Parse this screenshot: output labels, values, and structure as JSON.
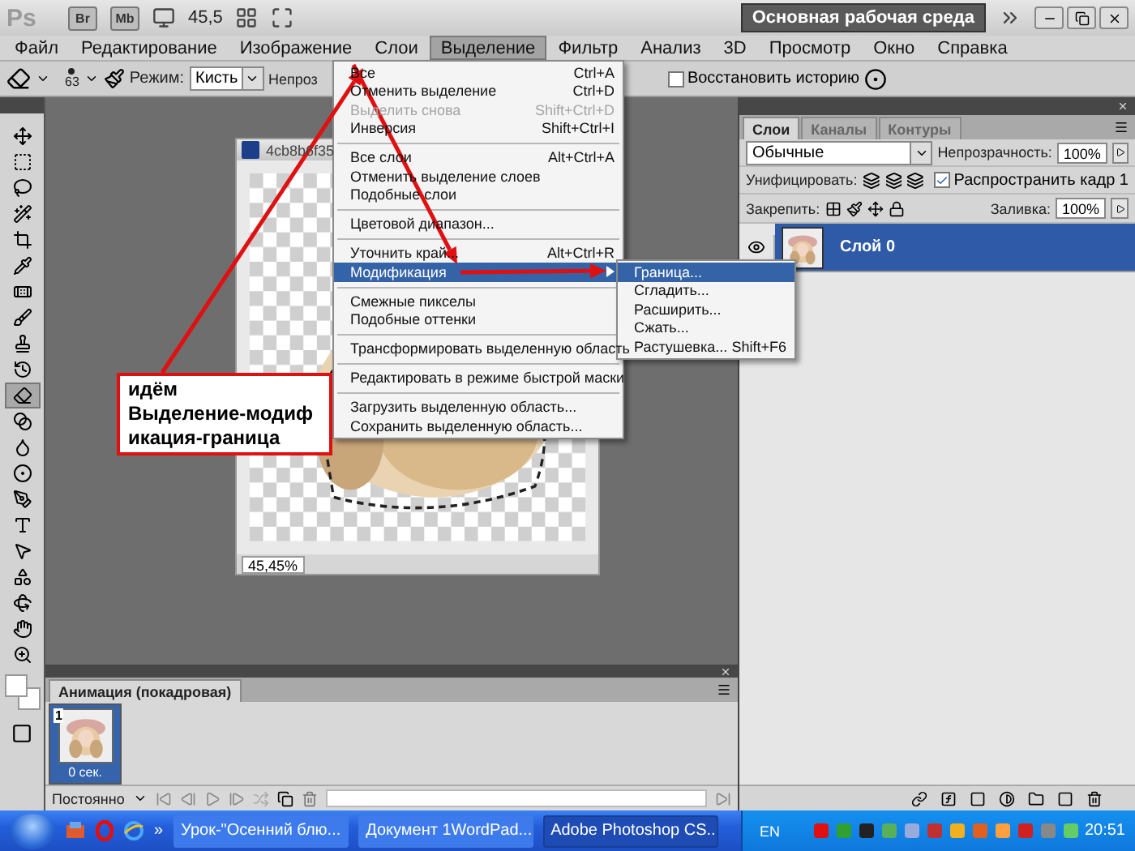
{
  "app_bar": {
    "logo": "Ps",
    "buttons": [
      "Br",
      "Mb"
    ],
    "zoom": "45,5",
    "workspace": "Основная рабочая среда"
  },
  "menu_bar": [
    {
      "label": "Файл",
      "selected": false
    },
    {
      "label": "Редактирование",
      "selected": false
    },
    {
      "label": "Изображение",
      "selected": false
    },
    {
      "label": "Слои",
      "selected": false
    },
    {
      "label": "Выделение",
      "selected": true
    },
    {
      "label": "Фильтр",
      "selected": false
    },
    {
      "label": "Анализ",
      "selected": false
    },
    {
      "label": "3D",
      "selected": false
    },
    {
      "label": "Просмотр",
      "selected": false
    },
    {
      "label": "Окно",
      "selected": false
    },
    {
      "label": "Справка",
      "selected": false
    }
  ],
  "options_bar": {
    "brush_size": "63",
    "mode_label": "Режим:",
    "mode_value": "Кисть",
    "opacity_label": "Непроз",
    "restore_history": {
      "label": "Восстановить историю",
      "checked": false
    }
  },
  "tools": [
    {
      "selected": false
    },
    {
      "selected": false
    },
    {
      "selected": false
    },
    {
      "selected": false
    },
    {
      "selected": false
    },
    {
      "selected": false
    },
    {
      "selected": false
    },
    {
      "selected": false
    },
    {
      "selected": false
    },
    {
      "selected": false
    },
    {
      "selected": true
    },
    {
      "selected": false
    },
    {
      "selected": false
    },
    {
      "selected": false
    },
    {
      "selected": false
    },
    {
      "selected": false
    },
    {
      "selected": false
    },
    {
      "selected": false
    },
    {
      "selected": false
    },
    {
      "selected": false
    },
    {
      "selected": false
    }
  ],
  "document": {
    "title": "4cb8b6f35",
    "zoom": "45,45%"
  },
  "dropdown_menu": {
    "sections": [
      [
        {
          "label": "Все",
          "shortcut": "Ctrl+A",
          "disabled": false,
          "selected": false
        },
        {
          "label": "Отменить выделение",
          "shortcut": "Ctrl+D",
          "disabled": false,
          "selected": false
        },
        {
          "label": "Выделить снова",
          "shortcut": "Shift+Ctrl+D",
          "disabled": true,
          "selected": false
        },
        {
          "label": "Инверсия",
          "shortcut": "Shift+Ctrl+I",
          "disabled": false,
          "selected": false
        }
      ],
      [
        {
          "label": "Все слои",
          "shortcut": "Alt+Ctrl+A",
          "disabled": false,
          "selected": false
        },
        {
          "label": "Отменить выделение слоев",
          "disabled": false,
          "selected": false
        },
        {
          "label": "Подобные слои",
          "disabled": false,
          "selected": false
        }
      ],
      [
        {
          "label": "Цветовой диапазон...",
          "disabled": false,
          "selected": false
        }
      ],
      [
        {
          "label": "Уточнить край...",
          "shortcut": "Alt+Ctrl+R",
          "disabled": false,
          "selected": false
        },
        {
          "label": "Модификация",
          "disabled": false,
          "selected": true,
          "submenu": true
        }
      ],
      [
        {
          "label": "Смежные пикселы",
          "disabled": false,
          "selected": false
        },
        {
          "label": "Подобные оттенки",
          "disabled": false,
          "selected": false
        }
      ],
      [
        {
          "label": "Трансформировать выделенную область",
          "disabled": false,
          "selected": false
        }
      ],
      [
        {
          "label": "Редактировать в режиме быстрой маски",
          "disabled": false,
          "selected": false
        }
      ],
      [
        {
          "label": "Загрузить выделенную область...",
          "disabled": false,
          "selected": false
        },
        {
          "label": "Сохранить выделенную область...",
          "disabled": false,
          "selected": false
        }
      ]
    ]
  },
  "submenu": [
    {
      "label": "Граница...",
      "selected": true
    },
    {
      "label": "Сгладить...",
      "selected": false
    },
    {
      "label": "Расширить...",
      "selected": false
    },
    {
      "label": "Сжать...",
      "selected": false
    },
    {
      "label": "Растушевка...",
      "shortcut": "Shift+F6",
      "selected": false
    }
  ],
  "callout": {
    "text": "идём\nВыделение-модиф\nикация-граница"
  },
  "layers_panel": {
    "tabs": [
      {
        "label": "Слои",
        "selected": true
      },
      {
        "label": "Каналы",
        "selected": false
      },
      {
        "label": "Контуры",
        "selected": false
      }
    ],
    "blend_mode": "Обычные",
    "opacity_label": "Непрозрачность:",
    "opacity": "100%",
    "unify_label": "Унифицировать:",
    "propagate": {
      "label": "Распространить кадр 1",
      "checked": true
    },
    "lock_label": "Закрепить:",
    "fill_label": "Заливка:",
    "fill": "100%",
    "layers": [
      {
        "name": "Слой 0",
        "selected": true,
        "visible": true
      }
    ]
  },
  "animation_panel": {
    "title": "Анимация (покадровая)",
    "frames": [
      {
        "number": "1",
        "delay": "0 сек.",
        "selected": true
      }
    ],
    "loop": "Постоянно"
  },
  "taskbar": {
    "more": "»",
    "tasks": [
      {
        "label": "Урок-\"Осенний блю...",
        "selected": false
      },
      {
        "label": "Документ 1WordPad...",
        "selected": false
      },
      {
        "label": "Adobe Photoshop CS...",
        "selected": true
      }
    ],
    "language": "EN",
    "clock": "20:51"
  }
}
